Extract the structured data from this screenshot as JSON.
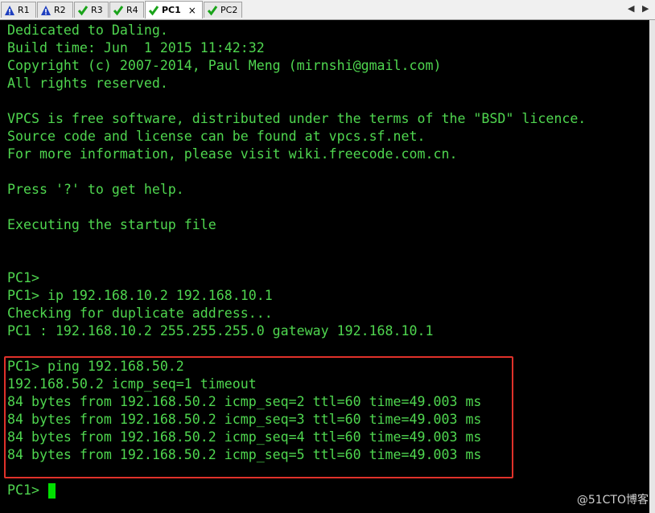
{
  "tabs": [
    {
      "label": "R1",
      "icon": "warning-icon"
    },
    {
      "label": "R2",
      "icon": "warning-icon"
    },
    {
      "label": "R3",
      "icon": "check-icon"
    },
    {
      "label": "R4",
      "icon": "check-icon"
    },
    {
      "label": "PC1",
      "icon": "check-icon",
      "active": true,
      "close": "×"
    },
    {
      "label": "PC2",
      "icon": "check-icon"
    }
  ],
  "nav": {
    "left": "◀",
    "right": "▶"
  },
  "terminal": {
    "lines": [
      "Dedicated to Daling.",
      "Build time: Jun  1 2015 11:42:32",
      "Copyright (c) 2007-2014, Paul Meng (mirnshi@gmail.com)",
      "All rights reserved.",
      "",
      "VPCS is free software, distributed under the terms of the \"BSD\" licence.",
      "Source code and license can be found at vpcs.sf.net.",
      "For more information, please visit wiki.freecode.com.cn.",
      "",
      "Press '?' to get help.",
      "",
      "Executing the startup file",
      "",
      "",
      "",
      "PC1>",
      "PC1> ip 192.168.10.2 192.168.10.1",
      "Checking for duplicate address...",
      "PC1 : 192.168.10.2 255.255.255.0 gateway 192.168.10.1",
      "",
      "PC1> ping 192.168.50.2",
      "192.168.50.2 icmp_seq=1 timeout",
      "84 bytes from 192.168.50.2 icmp_seq=2 ttl=60 time=49.003 ms",
      "84 bytes from 192.168.50.2 icmp_seq=3 ttl=60 time=49.003 ms",
      "84 bytes from 192.168.50.2 icmp_seq=4 ttl=60 time=49.003 ms",
      "84 bytes from 192.168.50.2 icmp_seq=5 ttl=60 time=49.003 ms",
      "",
      "PC1>"
    ],
    "text_color": "#4fd64f",
    "background": "#000000",
    "highlight_color": "#e0312a"
  },
  "watermark": "@51CTO博客"
}
